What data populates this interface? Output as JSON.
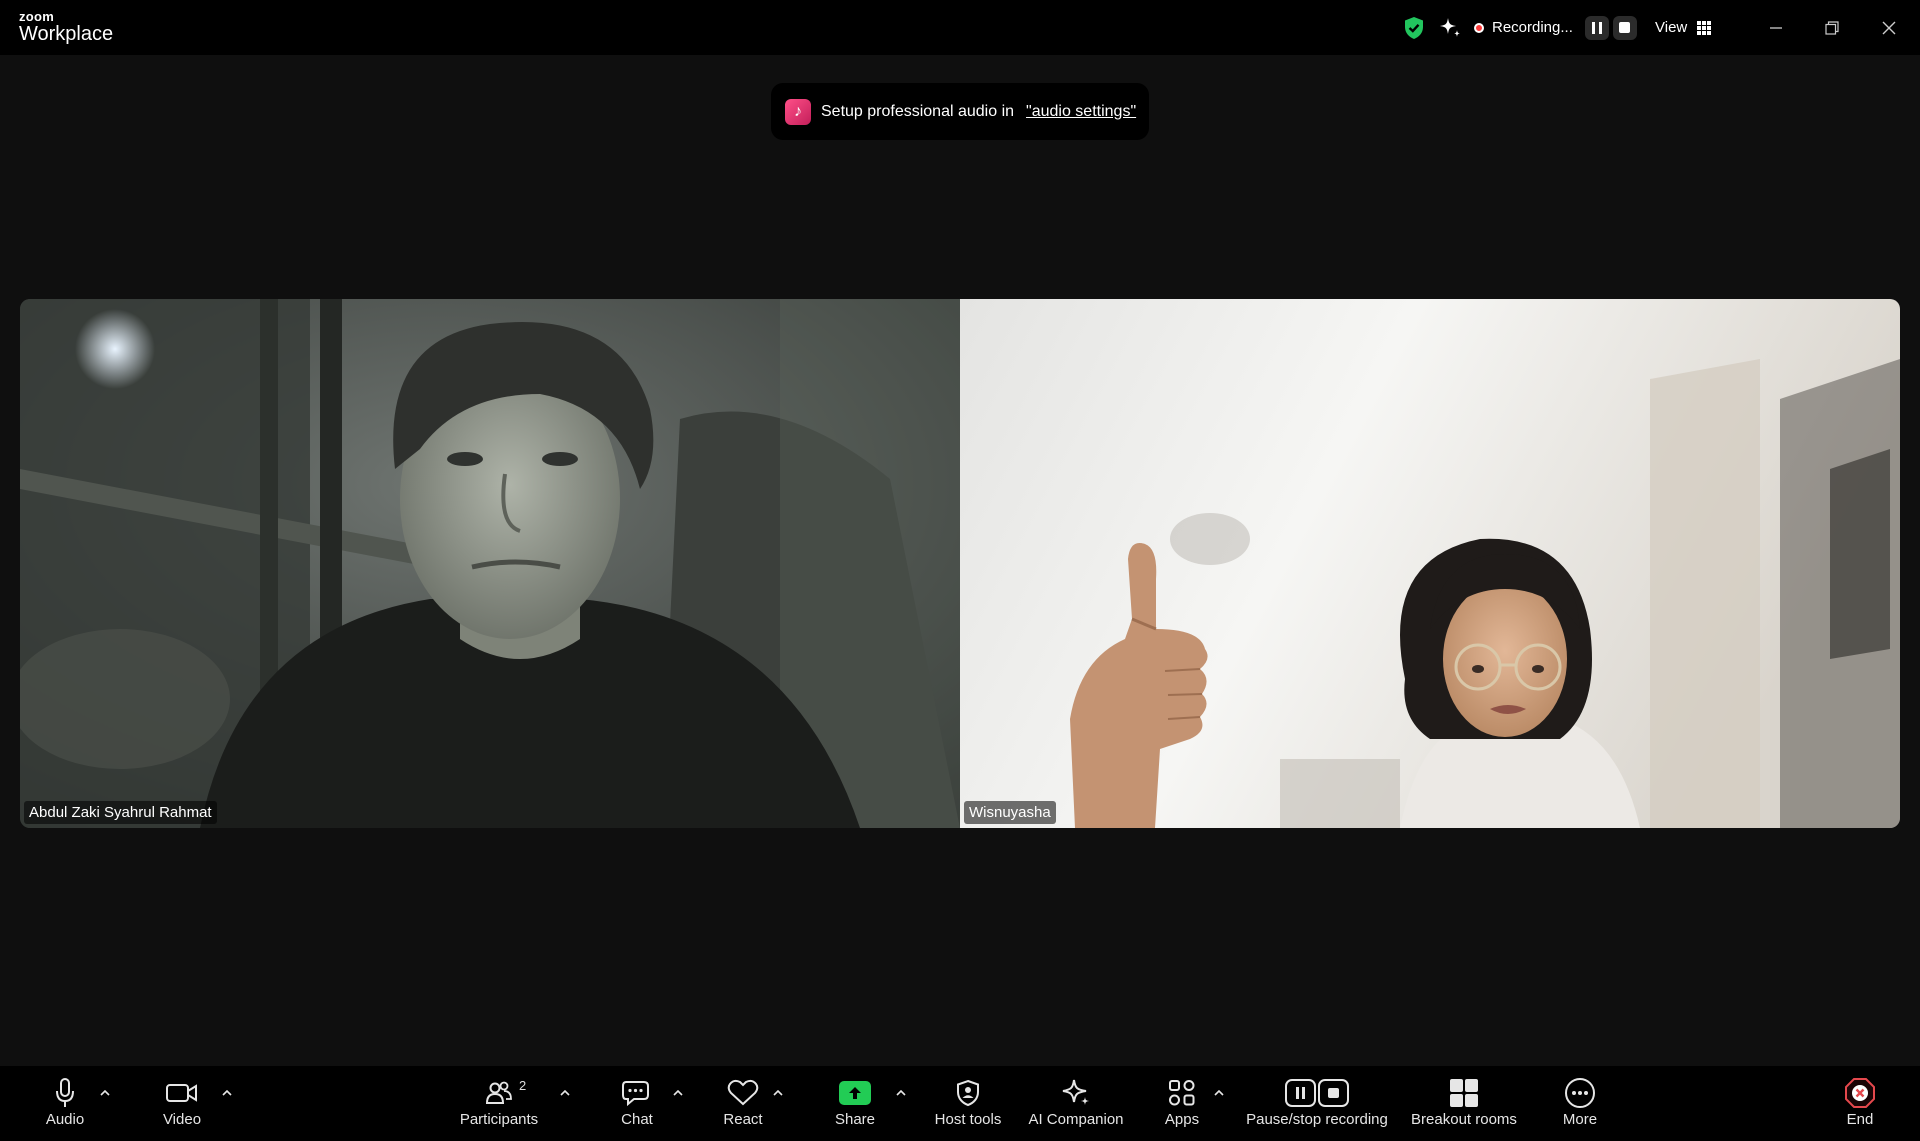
{
  "titlebar": {
    "logo_top": "zoom",
    "logo_bottom": "Workplace",
    "recording_label": "Recording...",
    "view_label": "View"
  },
  "notice": {
    "text": "Setup professional audio in",
    "link": "\"audio settings\""
  },
  "participants": [
    {
      "name": "Abdul Zaki Syahrul Rahmat"
    },
    {
      "name": "Wisnuyasha"
    }
  ],
  "toolbar": {
    "audio": "Audio",
    "video": "Video",
    "participants": "Participants",
    "participants_count": "2",
    "chat": "Chat",
    "react": "React",
    "share": "Share",
    "host_tools": "Host tools",
    "ai_companion": "AI Companion",
    "apps": "Apps",
    "pause_stop_recording": "Pause/stop recording",
    "breakout_rooms": "Breakout rooms",
    "more": "More",
    "end": "End"
  },
  "colors": {
    "security_shield": "#22c55e",
    "recording_dot": "#ff3b3b",
    "share_green": "#22cc55",
    "end_red": "#e5484d",
    "audio_note_pink": "#ff4f88"
  },
  "icons": [
    "shield-icon",
    "ai-sparkle-icon",
    "recording-dot-icon",
    "pause-icon",
    "stop-icon",
    "grid-view-icon",
    "minimize-icon",
    "restore-icon",
    "close-icon",
    "music-note-icon",
    "microphone-icon",
    "video-camera-icon",
    "participants-icon",
    "chat-icon",
    "heart-icon",
    "share-arrow-icon",
    "host-shield-icon",
    "apps-icon",
    "breakout-grid-icon",
    "more-ellipsis-icon",
    "end-x-icon",
    "caret-up-icon"
  ]
}
